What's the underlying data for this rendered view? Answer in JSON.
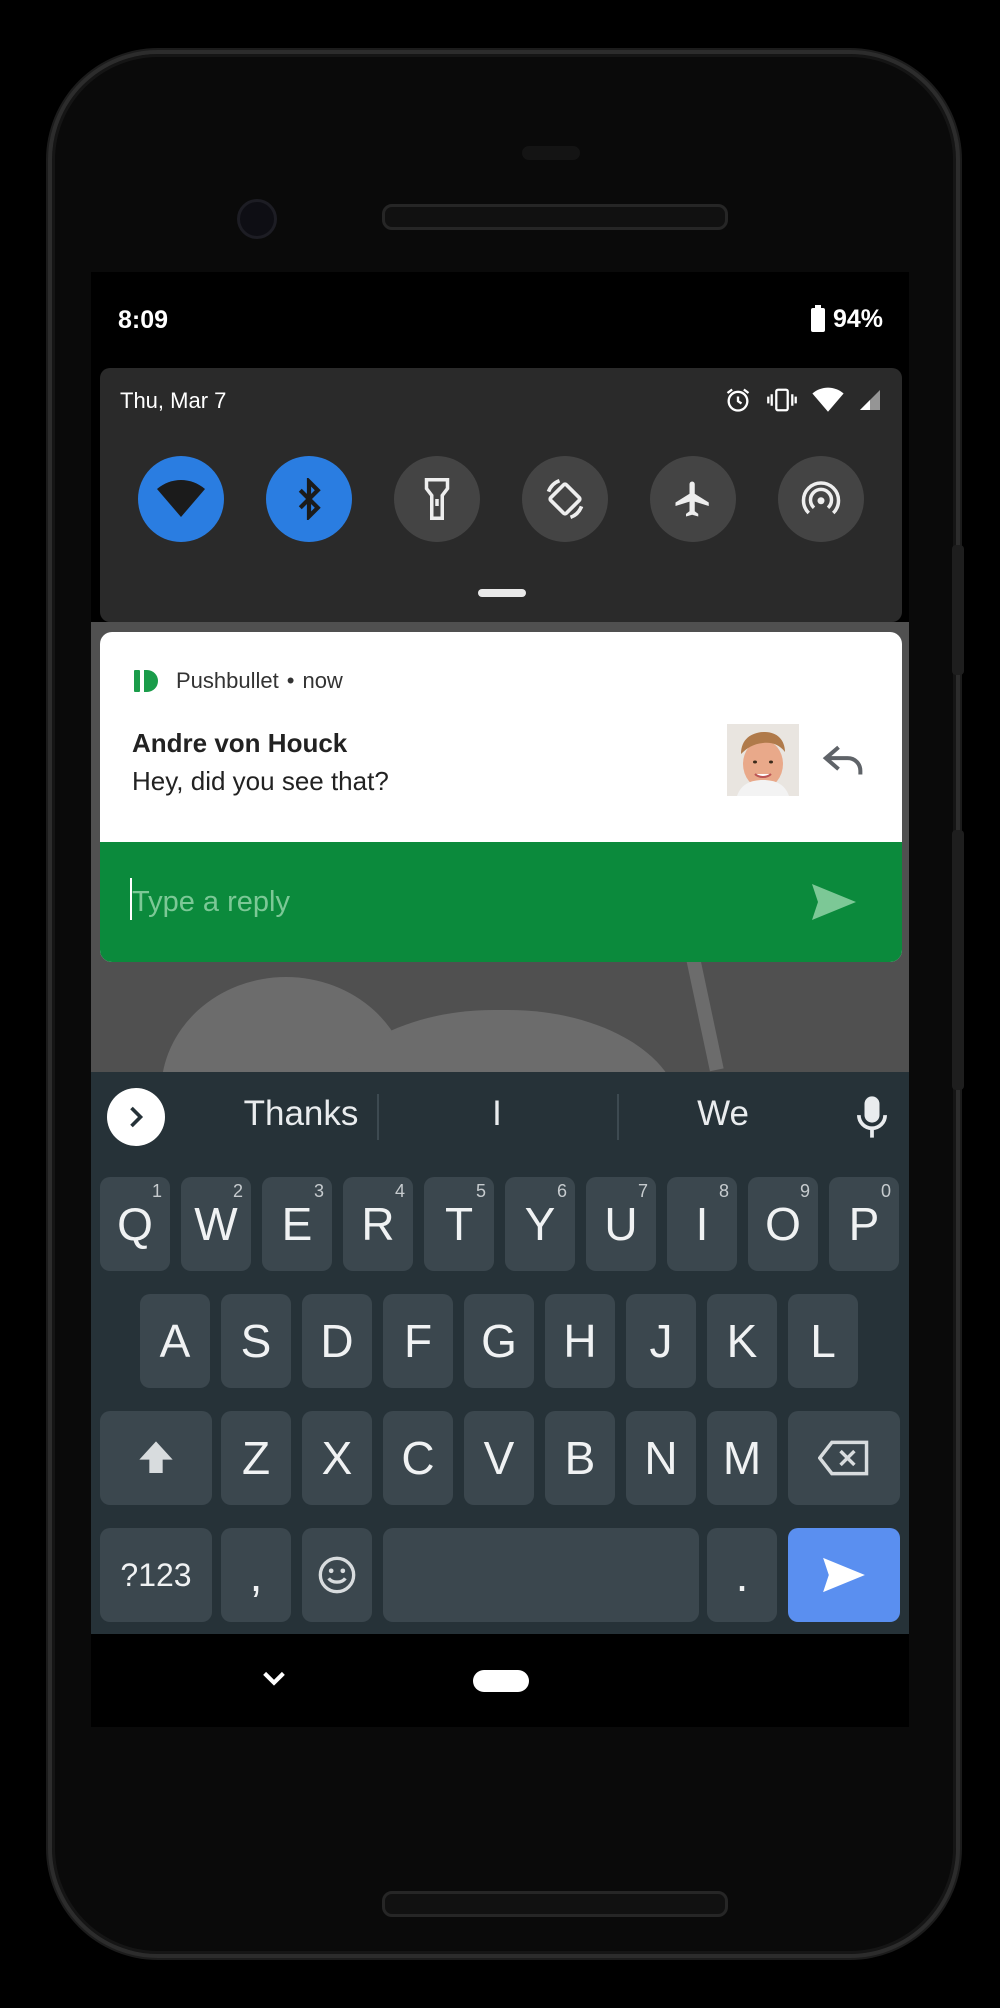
{
  "status_bar": {
    "time": "8:09",
    "battery": "94%"
  },
  "quick_settings": {
    "date": "Thu, Mar 7",
    "status_icons": [
      "alarm-icon",
      "vibrate-icon",
      "wifi-icon",
      "cell-signal-icon"
    ],
    "tiles": [
      {
        "name": "wifi",
        "icon": "wifi-icon",
        "on": true
      },
      {
        "name": "bluetooth",
        "icon": "bluetooth-icon",
        "on": true
      },
      {
        "name": "flashlight",
        "icon": "flashlight-icon",
        "on": false
      },
      {
        "name": "auto-rotate",
        "icon": "auto-rotate-icon",
        "on": false
      },
      {
        "name": "airplane-mode",
        "icon": "airplane-icon",
        "on": false
      },
      {
        "name": "hotspot",
        "icon": "hotspot-icon",
        "on": false
      }
    ]
  },
  "notification": {
    "app": "Pushbullet",
    "separator": "•",
    "time": "now",
    "sender": "Andre von Houck",
    "message": "Hey, did you see that?",
    "reply_placeholder": "Type a reply",
    "accent_color": "#0b8a3c",
    "brand_color": "#1a9c4a"
  },
  "keyboard": {
    "suggestions": [
      "Thanks",
      "I",
      "We"
    ],
    "row1": [
      {
        "k": "Q",
        "n": "1"
      },
      {
        "k": "W",
        "n": "2"
      },
      {
        "k": "E",
        "n": "3"
      },
      {
        "k": "R",
        "n": "4"
      },
      {
        "k": "T",
        "n": "5"
      },
      {
        "k": "Y",
        "n": "6"
      },
      {
        "k": "U",
        "n": "7"
      },
      {
        "k": "I",
        "n": "8"
      },
      {
        "k": "O",
        "n": "9"
      },
      {
        "k": "P",
        "n": "0"
      }
    ],
    "row2": [
      "A",
      "S",
      "D",
      "F",
      "G",
      "H",
      "J",
      "K",
      "L"
    ],
    "row3": [
      "Z",
      "X",
      "C",
      "V",
      "B",
      "N",
      "M"
    ],
    "symbols_label": "?123",
    "comma": ",",
    "period": ".",
    "send_color": "#5a8ff0"
  }
}
